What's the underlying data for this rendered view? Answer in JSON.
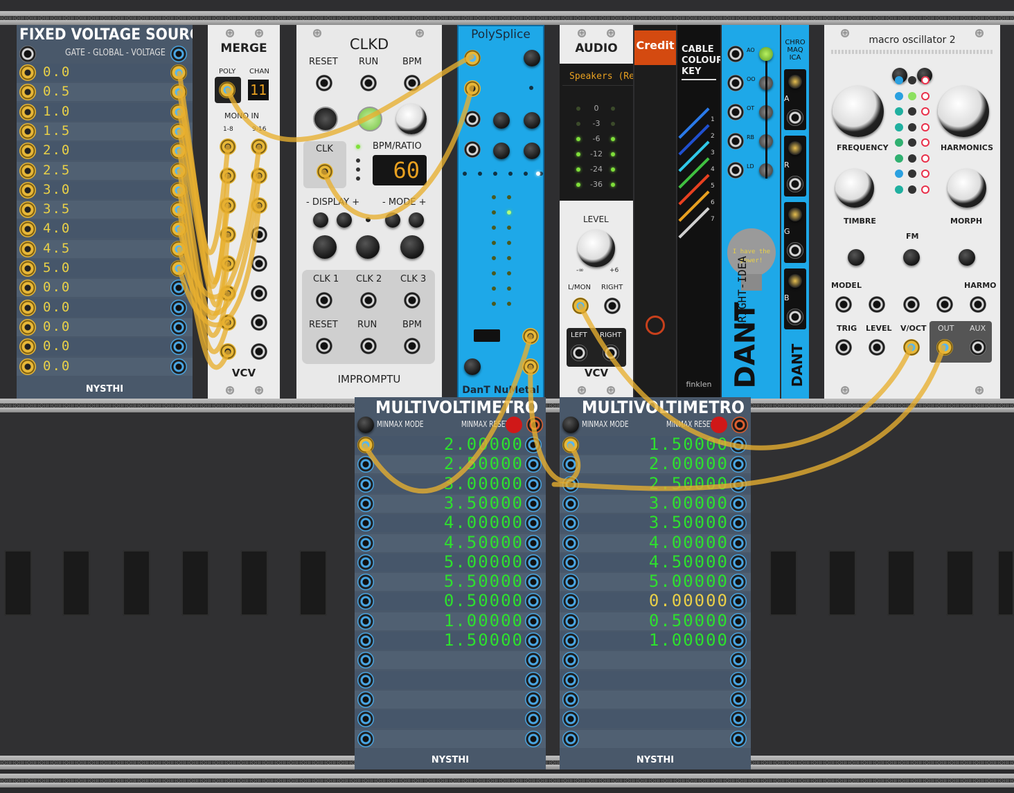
{
  "fixed_voltage_source": {
    "title": "FIXED VOLTAGE SOURCE",
    "subtitle": "GATE - GLOBAL - VOLTAGE",
    "brand": "NYSTHI",
    "values": [
      "0.0",
      "0.5",
      "1.0",
      "1.5",
      "2.0",
      "2.5",
      "3.0",
      "3.5",
      "4.0",
      "4.5",
      "5.0",
      "0.0",
      "0.0",
      "0.0",
      "0.0",
      "0.0"
    ]
  },
  "merge": {
    "title": "MERGE",
    "poly_label": "POLY",
    "chan_label": "CHAN",
    "chan_value": "11",
    "mono_in_label": "MONO IN",
    "range1": "1-8",
    "range2": "9-16",
    "brand": "VCV"
  },
  "clkd": {
    "title": "CLKD",
    "labels": {
      "reset": "RESET",
      "run": "RUN",
      "bpm": "BPM",
      "clk": "CLK",
      "bpm_ratio": "BPM/RATIO",
      "display": "- DISPLAY +",
      "mode": "- MODE +",
      "clk1": "CLK 1",
      "clk2": "CLK 2",
      "clk3": "CLK 3",
      "reset2": "RESET",
      "run2": "RUN",
      "bpm2": "BPM"
    },
    "bpm_value": "60",
    "brand": "IMPROMPTU"
  },
  "polysplice": {
    "title": "PolySplice",
    "brand": "DanT NuMetal"
  },
  "audio": {
    "title": "AUDIO",
    "device": "Speakers (Re",
    "meter_labels": [
      "0",
      "-3",
      "-6",
      "-12",
      "-24",
      "-36"
    ],
    "level_label": "LEVEL",
    "level_min": "-∞",
    "level_max": "+6",
    "lmon_label": "L/MON",
    "right_label": "RIGHT",
    "left_out": "LEFT",
    "right_out": "RIGHT",
    "brand": "VCV"
  },
  "credit": {
    "title": "Credit"
  },
  "cable_colour_key": {
    "title": "CABLE COLOUR KEY",
    "numbers": [
      "1",
      "2",
      "3",
      "4",
      "5",
      "6",
      "7"
    ],
    "brand": "finklen"
  },
  "dant_bright_idea": {
    "tagline": "I have the power!",
    "name": "BRIGHT-IDEA",
    "logo": "DANT",
    "jack_labels": [
      "AO",
      "OO",
      "OT",
      "RB",
      "LD"
    ]
  },
  "chromaqica": {
    "title": "CHRO MAQ ICA",
    "labels": [
      "A",
      "R",
      "G",
      "B"
    ],
    "logo": "DANT"
  },
  "macro_oscillator": {
    "title": "macro oscillator 2",
    "frequency": "FREQUENCY",
    "harmonics": "HARMONICS",
    "timbre": "TIMBRE",
    "morph": "MORPH",
    "fm": "FM",
    "model": "MODEL",
    "harmo": "HARMO",
    "trig": "TRIG",
    "level": "LEVEL",
    "voct": "V/OCT",
    "out": "OUT",
    "aux": "AUX"
  },
  "multivoltimetro_1": {
    "title": "MULTIVOLTIMETRO",
    "minmax_mode": "MINMAX MODE",
    "minmax_reset": "MINMAX RESET",
    "brand": "NYSTHI",
    "values": [
      "2.00000",
      "2.50000",
      "3.00000",
      "3.50000",
      "4.00000",
      "4.50000",
      "5.00000",
      "5.50000",
      "0.50000",
      "1.00000",
      "1.50000",
      "",
      "",
      "",
      "",
      ""
    ]
  },
  "multivoltimetro_2": {
    "title": "MULTIVOLTIMETRO",
    "minmax_mode": "MINMAX MODE",
    "minmax_reset": "MINMAX RESET",
    "brand": "NYSTHI",
    "values": [
      "1.50000",
      "2.00000",
      "2.50000",
      "3.00000",
      "3.50000",
      "4.00000",
      "4.50000",
      "5.00000",
      "0.00000",
      "0.50000",
      "1.00000",
      "",
      "",
      "",
      "",
      ""
    ]
  },
  "colors": {
    "cable": "#e8b030",
    "display_green": "#2ee02e",
    "display_yellow": "#e8d048",
    "polysplice_blue": "#1ea8e8",
    "credit_orange": "#d44a10"
  }
}
